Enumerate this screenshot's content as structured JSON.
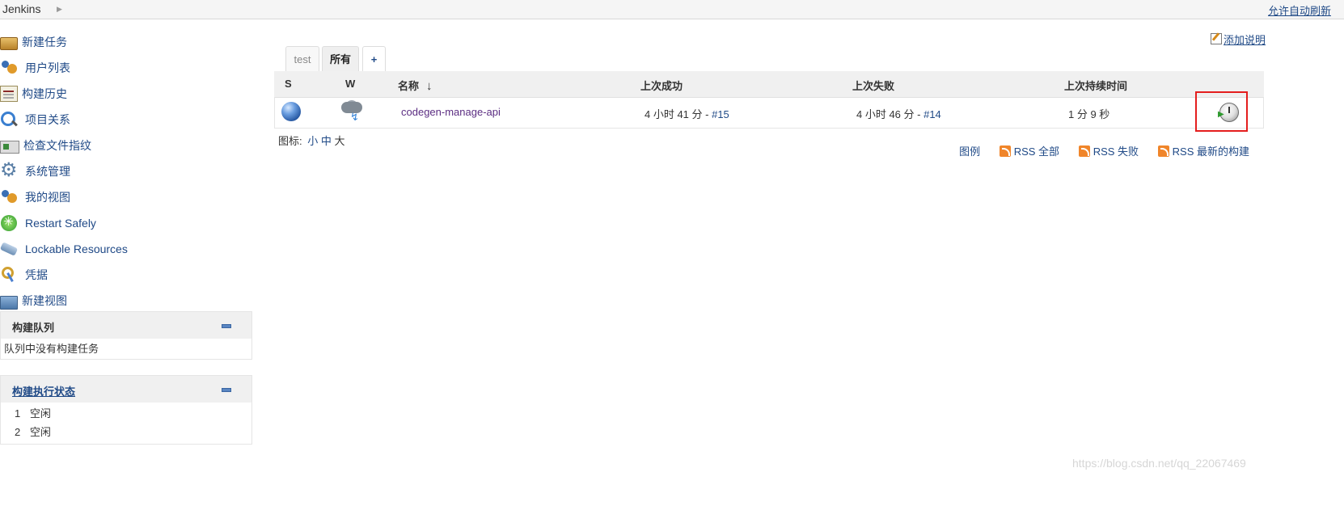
{
  "breadcrumb": {
    "root": "Jenkins",
    "auto_refresh": "允许自动刷新"
  },
  "sidebar": {
    "items": [
      {
        "label": "新建任务",
        "icon": "new-job-icon"
      },
      {
        "label": "用户列表",
        "icon": "users-icon"
      },
      {
        "label": "构建历史",
        "icon": "build-history-icon"
      },
      {
        "label": "项目关系",
        "icon": "search-icon"
      },
      {
        "label": "检查文件指纹",
        "icon": "fingerprint-icon"
      },
      {
        "label": "系统管理",
        "icon": "gear-icon"
      },
      {
        "label": "我的视图",
        "icon": "users-icon"
      },
      {
        "label": "Restart Safely",
        "icon": "restart-icon"
      },
      {
        "label": "Lockable Resources",
        "icon": "lock-icon"
      },
      {
        "label": "凭据",
        "icon": "keys-icon"
      },
      {
        "label": "新建视图",
        "icon": "folder-icon"
      }
    ]
  },
  "build_queue": {
    "title": "构建队列",
    "empty_text": "队列中没有构建任务"
  },
  "executors": {
    "title": "构建执行状态",
    "rows": [
      {
        "num": "1",
        "status": "空闲"
      },
      {
        "num": "2",
        "status": "空闲"
      }
    ]
  },
  "add_description": "添加说明",
  "tabs": [
    {
      "label": "test",
      "active": false
    },
    {
      "label": "所有",
      "active": true
    },
    {
      "label": "+",
      "active": false
    }
  ],
  "table": {
    "headers": {
      "s": "S",
      "w": "W",
      "name": "名称",
      "sort_arrow": "↓",
      "last_success": "上次成功",
      "last_failure": "上次失败",
      "last_duration": "上次持续时间"
    },
    "rows": [
      {
        "name": "codegen-manage-api",
        "last_success_text": "4 小时 41 分 - ",
        "last_success_link": "#15",
        "last_failure_text": "4 小时 46 分 - ",
        "last_failure_link": "#14",
        "duration": "1 分 9 秒"
      }
    ]
  },
  "icon_size": {
    "label": "图标:",
    "small": "小",
    "medium": "中",
    "large": "大"
  },
  "rss": {
    "legend": "图例",
    "all": "RSS 全部",
    "failures": "RSS 失败",
    "latest": "RSS 最新的构建"
  },
  "watermark": "https://blog.csdn.net/qq_22067469"
}
